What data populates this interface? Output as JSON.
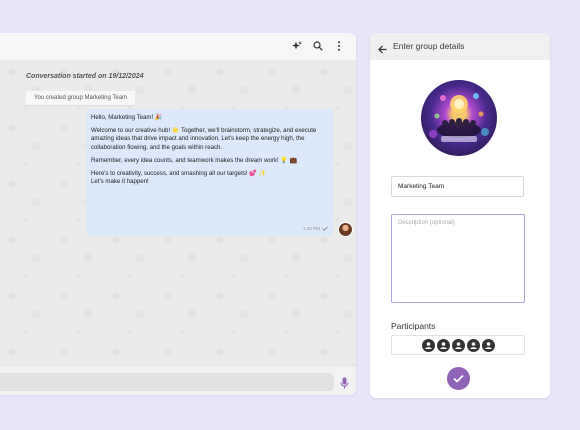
{
  "chat": {
    "header_icons": [
      "sparkles-icon",
      "search-icon",
      "more-vertical-icon"
    ],
    "conversation_started": "Conversation started on 19/12/2024",
    "system_message": "You created group Marketing Team",
    "message": {
      "paragraphs": [
        "Hello, Marketing Team! 🎉",
        "Welcome to our creative hub! 🌟 Together, we'll brainstorm, strategize, and execute amazing ideas that drive impact and innovation. Let's keep the energy high, the collaboration flowing, and the goals within reach.",
        "Remember, every idea counts, and teamwork makes the dream work! 💡 💼",
        "Here's to creativity, success, and smashing all our targets! 💕 ✨\nLet's make it happen!"
      ],
      "time": "1:44 PM"
    },
    "composer": {
      "placeholder": ""
    }
  },
  "details": {
    "title": "Enter group details",
    "name_value": "Marketing Team",
    "description_placeholder": "Description (optional)",
    "participants_label": "Participants",
    "participant_count": 5
  },
  "colors": {
    "background": "#e8e6fb",
    "bubble": "#dbe9fb",
    "accent": "#8e63b8",
    "description_border": "#b49fe0"
  }
}
